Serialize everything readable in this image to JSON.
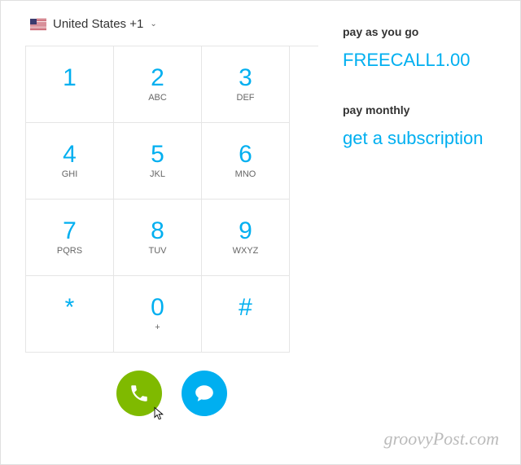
{
  "country": {
    "label": "United States +1"
  },
  "keypad": [
    {
      "digit": "1",
      "letters": ""
    },
    {
      "digit": "2",
      "letters": "ABC"
    },
    {
      "digit": "3",
      "letters": "DEF"
    },
    {
      "digit": "4",
      "letters": "GHI"
    },
    {
      "digit": "5",
      "letters": "JKL"
    },
    {
      "digit": "6",
      "letters": "MNO"
    },
    {
      "digit": "7",
      "letters": "PQRS"
    },
    {
      "digit": "8",
      "letters": "TUV"
    },
    {
      "digit": "9",
      "letters": "WXYZ"
    },
    {
      "digit": "*",
      "letters": ""
    },
    {
      "digit": "0",
      "letters": "+"
    },
    {
      "digit": "#",
      "letters": ""
    }
  ],
  "right": {
    "payg_label": "pay as you go",
    "payg_value": "FREECALL1.00",
    "monthly_label": "pay monthly",
    "monthly_value": "get a subscription"
  },
  "watermark": "groovyPost.com"
}
